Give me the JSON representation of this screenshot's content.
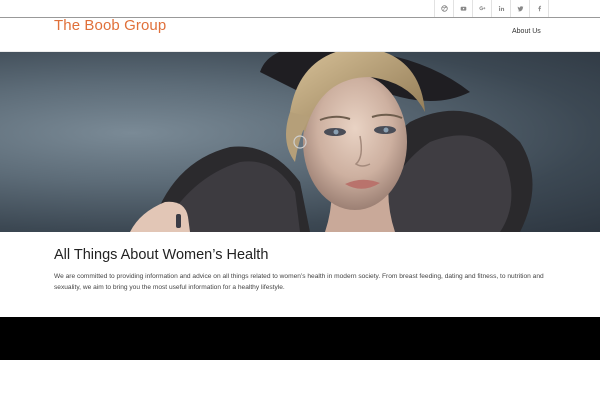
{
  "header": {
    "site_title": "The Boob Group",
    "nav": [
      {
        "label": "About Us"
      }
    ]
  },
  "social_icons": [
    "dribbble-icon",
    "youtube-icon",
    "google-plus-icon",
    "linkedin-icon",
    "twitter-icon",
    "facebook-icon"
  ],
  "hero": {
    "image": "woman-in-fur-coat-portrait"
  },
  "main": {
    "heading": "All Things About Women’s Health",
    "paragraph": "We are committed to providing information and advice on all things related to women’s health in modern society. From breast feeding, dating and fitness, to nutrition and sexuality, we aim to bring you the most useful information for a healthy lifestyle."
  },
  "colors": {
    "brand": "#e0703a",
    "text": "#333333",
    "footer": "#000000"
  }
}
